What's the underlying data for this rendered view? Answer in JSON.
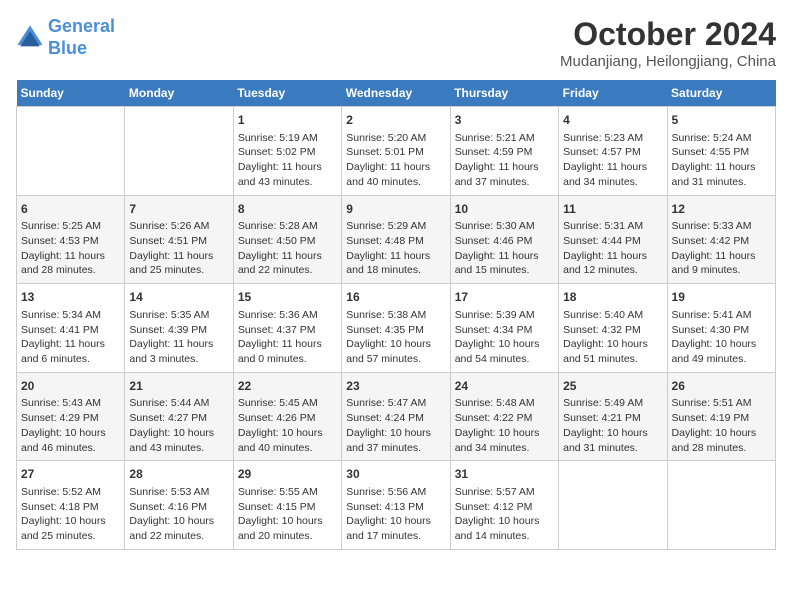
{
  "logo": {
    "line1": "General",
    "line2": "Blue"
  },
  "title": "October 2024",
  "subtitle": "Mudanjiang, Heilongjiang, China",
  "headers": [
    "Sunday",
    "Monday",
    "Tuesday",
    "Wednesday",
    "Thursday",
    "Friday",
    "Saturday"
  ],
  "weeks": [
    [
      {
        "day": "",
        "data": ""
      },
      {
        "day": "",
        "data": ""
      },
      {
        "day": "1",
        "data": "Sunrise: 5:19 AM\nSunset: 5:02 PM\nDaylight: 11 hours and 43 minutes."
      },
      {
        "day": "2",
        "data": "Sunrise: 5:20 AM\nSunset: 5:01 PM\nDaylight: 11 hours and 40 minutes."
      },
      {
        "day": "3",
        "data": "Sunrise: 5:21 AM\nSunset: 4:59 PM\nDaylight: 11 hours and 37 minutes."
      },
      {
        "day": "4",
        "data": "Sunrise: 5:23 AM\nSunset: 4:57 PM\nDaylight: 11 hours and 34 minutes."
      },
      {
        "day": "5",
        "data": "Sunrise: 5:24 AM\nSunset: 4:55 PM\nDaylight: 11 hours and 31 minutes."
      }
    ],
    [
      {
        "day": "6",
        "data": "Sunrise: 5:25 AM\nSunset: 4:53 PM\nDaylight: 11 hours and 28 minutes."
      },
      {
        "day": "7",
        "data": "Sunrise: 5:26 AM\nSunset: 4:51 PM\nDaylight: 11 hours and 25 minutes."
      },
      {
        "day": "8",
        "data": "Sunrise: 5:28 AM\nSunset: 4:50 PM\nDaylight: 11 hours and 22 minutes."
      },
      {
        "day": "9",
        "data": "Sunrise: 5:29 AM\nSunset: 4:48 PM\nDaylight: 11 hours and 18 minutes."
      },
      {
        "day": "10",
        "data": "Sunrise: 5:30 AM\nSunset: 4:46 PM\nDaylight: 11 hours and 15 minutes."
      },
      {
        "day": "11",
        "data": "Sunrise: 5:31 AM\nSunset: 4:44 PM\nDaylight: 11 hours and 12 minutes."
      },
      {
        "day": "12",
        "data": "Sunrise: 5:33 AM\nSunset: 4:42 PM\nDaylight: 11 hours and 9 minutes."
      }
    ],
    [
      {
        "day": "13",
        "data": "Sunrise: 5:34 AM\nSunset: 4:41 PM\nDaylight: 11 hours and 6 minutes."
      },
      {
        "day": "14",
        "data": "Sunrise: 5:35 AM\nSunset: 4:39 PM\nDaylight: 11 hours and 3 minutes."
      },
      {
        "day": "15",
        "data": "Sunrise: 5:36 AM\nSunset: 4:37 PM\nDaylight: 11 hours and 0 minutes."
      },
      {
        "day": "16",
        "data": "Sunrise: 5:38 AM\nSunset: 4:35 PM\nDaylight: 10 hours and 57 minutes."
      },
      {
        "day": "17",
        "data": "Sunrise: 5:39 AM\nSunset: 4:34 PM\nDaylight: 10 hours and 54 minutes."
      },
      {
        "day": "18",
        "data": "Sunrise: 5:40 AM\nSunset: 4:32 PM\nDaylight: 10 hours and 51 minutes."
      },
      {
        "day": "19",
        "data": "Sunrise: 5:41 AM\nSunset: 4:30 PM\nDaylight: 10 hours and 49 minutes."
      }
    ],
    [
      {
        "day": "20",
        "data": "Sunrise: 5:43 AM\nSunset: 4:29 PM\nDaylight: 10 hours and 46 minutes."
      },
      {
        "day": "21",
        "data": "Sunrise: 5:44 AM\nSunset: 4:27 PM\nDaylight: 10 hours and 43 minutes."
      },
      {
        "day": "22",
        "data": "Sunrise: 5:45 AM\nSunset: 4:26 PM\nDaylight: 10 hours and 40 minutes."
      },
      {
        "day": "23",
        "data": "Sunrise: 5:47 AM\nSunset: 4:24 PM\nDaylight: 10 hours and 37 minutes."
      },
      {
        "day": "24",
        "data": "Sunrise: 5:48 AM\nSunset: 4:22 PM\nDaylight: 10 hours and 34 minutes."
      },
      {
        "day": "25",
        "data": "Sunrise: 5:49 AM\nSunset: 4:21 PM\nDaylight: 10 hours and 31 minutes."
      },
      {
        "day": "26",
        "data": "Sunrise: 5:51 AM\nSunset: 4:19 PM\nDaylight: 10 hours and 28 minutes."
      }
    ],
    [
      {
        "day": "27",
        "data": "Sunrise: 5:52 AM\nSunset: 4:18 PM\nDaylight: 10 hours and 25 minutes."
      },
      {
        "day": "28",
        "data": "Sunrise: 5:53 AM\nSunset: 4:16 PM\nDaylight: 10 hours and 22 minutes."
      },
      {
        "day": "29",
        "data": "Sunrise: 5:55 AM\nSunset: 4:15 PM\nDaylight: 10 hours and 20 minutes."
      },
      {
        "day": "30",
        "data": "Sunrise: 5:56 AM\nSunset: 4:13 PM\nDaylight: 10 hours and 17 minutes."
      },
      {
        "day": "31",
        "data": "Sunrise: 5:57 AM\nSunset: 4:12 PM\nDaylight: 10 hours and 14 minutes."
      },
      {
        "day": "",
        "data": ""
      },
      {
        "day": "",
        "data": ""
      }
    ]
  ]
}
